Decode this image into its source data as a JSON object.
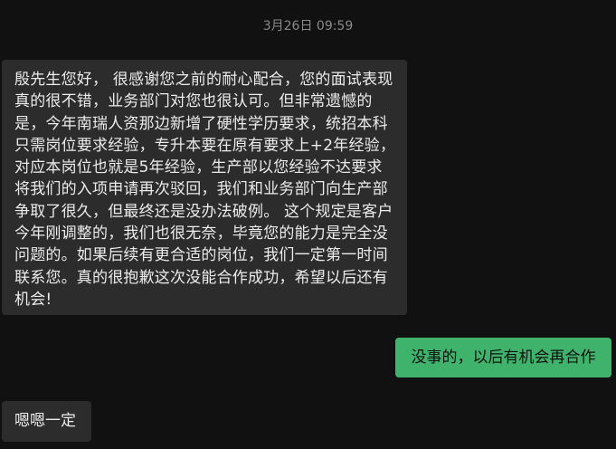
{
  "chat": {
    "timestamp": "3月26日 09:59",
    "messages": [
      {
        "side": "incoming",
        "text": "殷先生您好， 很感谢您之前的耐心配合，您的面试表现真的很不错，业务部门对您也很认可。但非常遗憾的是，今年南瑞人资那边新增了硬性学历要求，统招本科只需岗位要求经验，专升本要在原有要求上+2年经验，对应本岗位也就是5年经验，生产部以您经验不达要求将我们的入项申请再次驳回，我们和业务部门向生产部争取了很久，但最终还是没办法破例。 这个规定是客户今年刚调整的，我们也很无奈，毕竟您的能力是完全没问题的。如果后续有更合适的岗位，我们一定第一时间联系您。真的很抱歉这次没能合作成功，希望以后还有机会!"
      },
      {
        "side": "outgoing",
        "text": "没事的，以后有机会再合作"
      },
      {
        "side": "incoming",
        "text": "嗯嗯一定"
      }
    ]
  },
  "colors": {
    "background": "#111111",
    "incoming_bubble": "#2c2c2c",
    "outgoing_bubble": "#3fb36b",
    "timestamp_text": "#8a8a8a"
  }
}
